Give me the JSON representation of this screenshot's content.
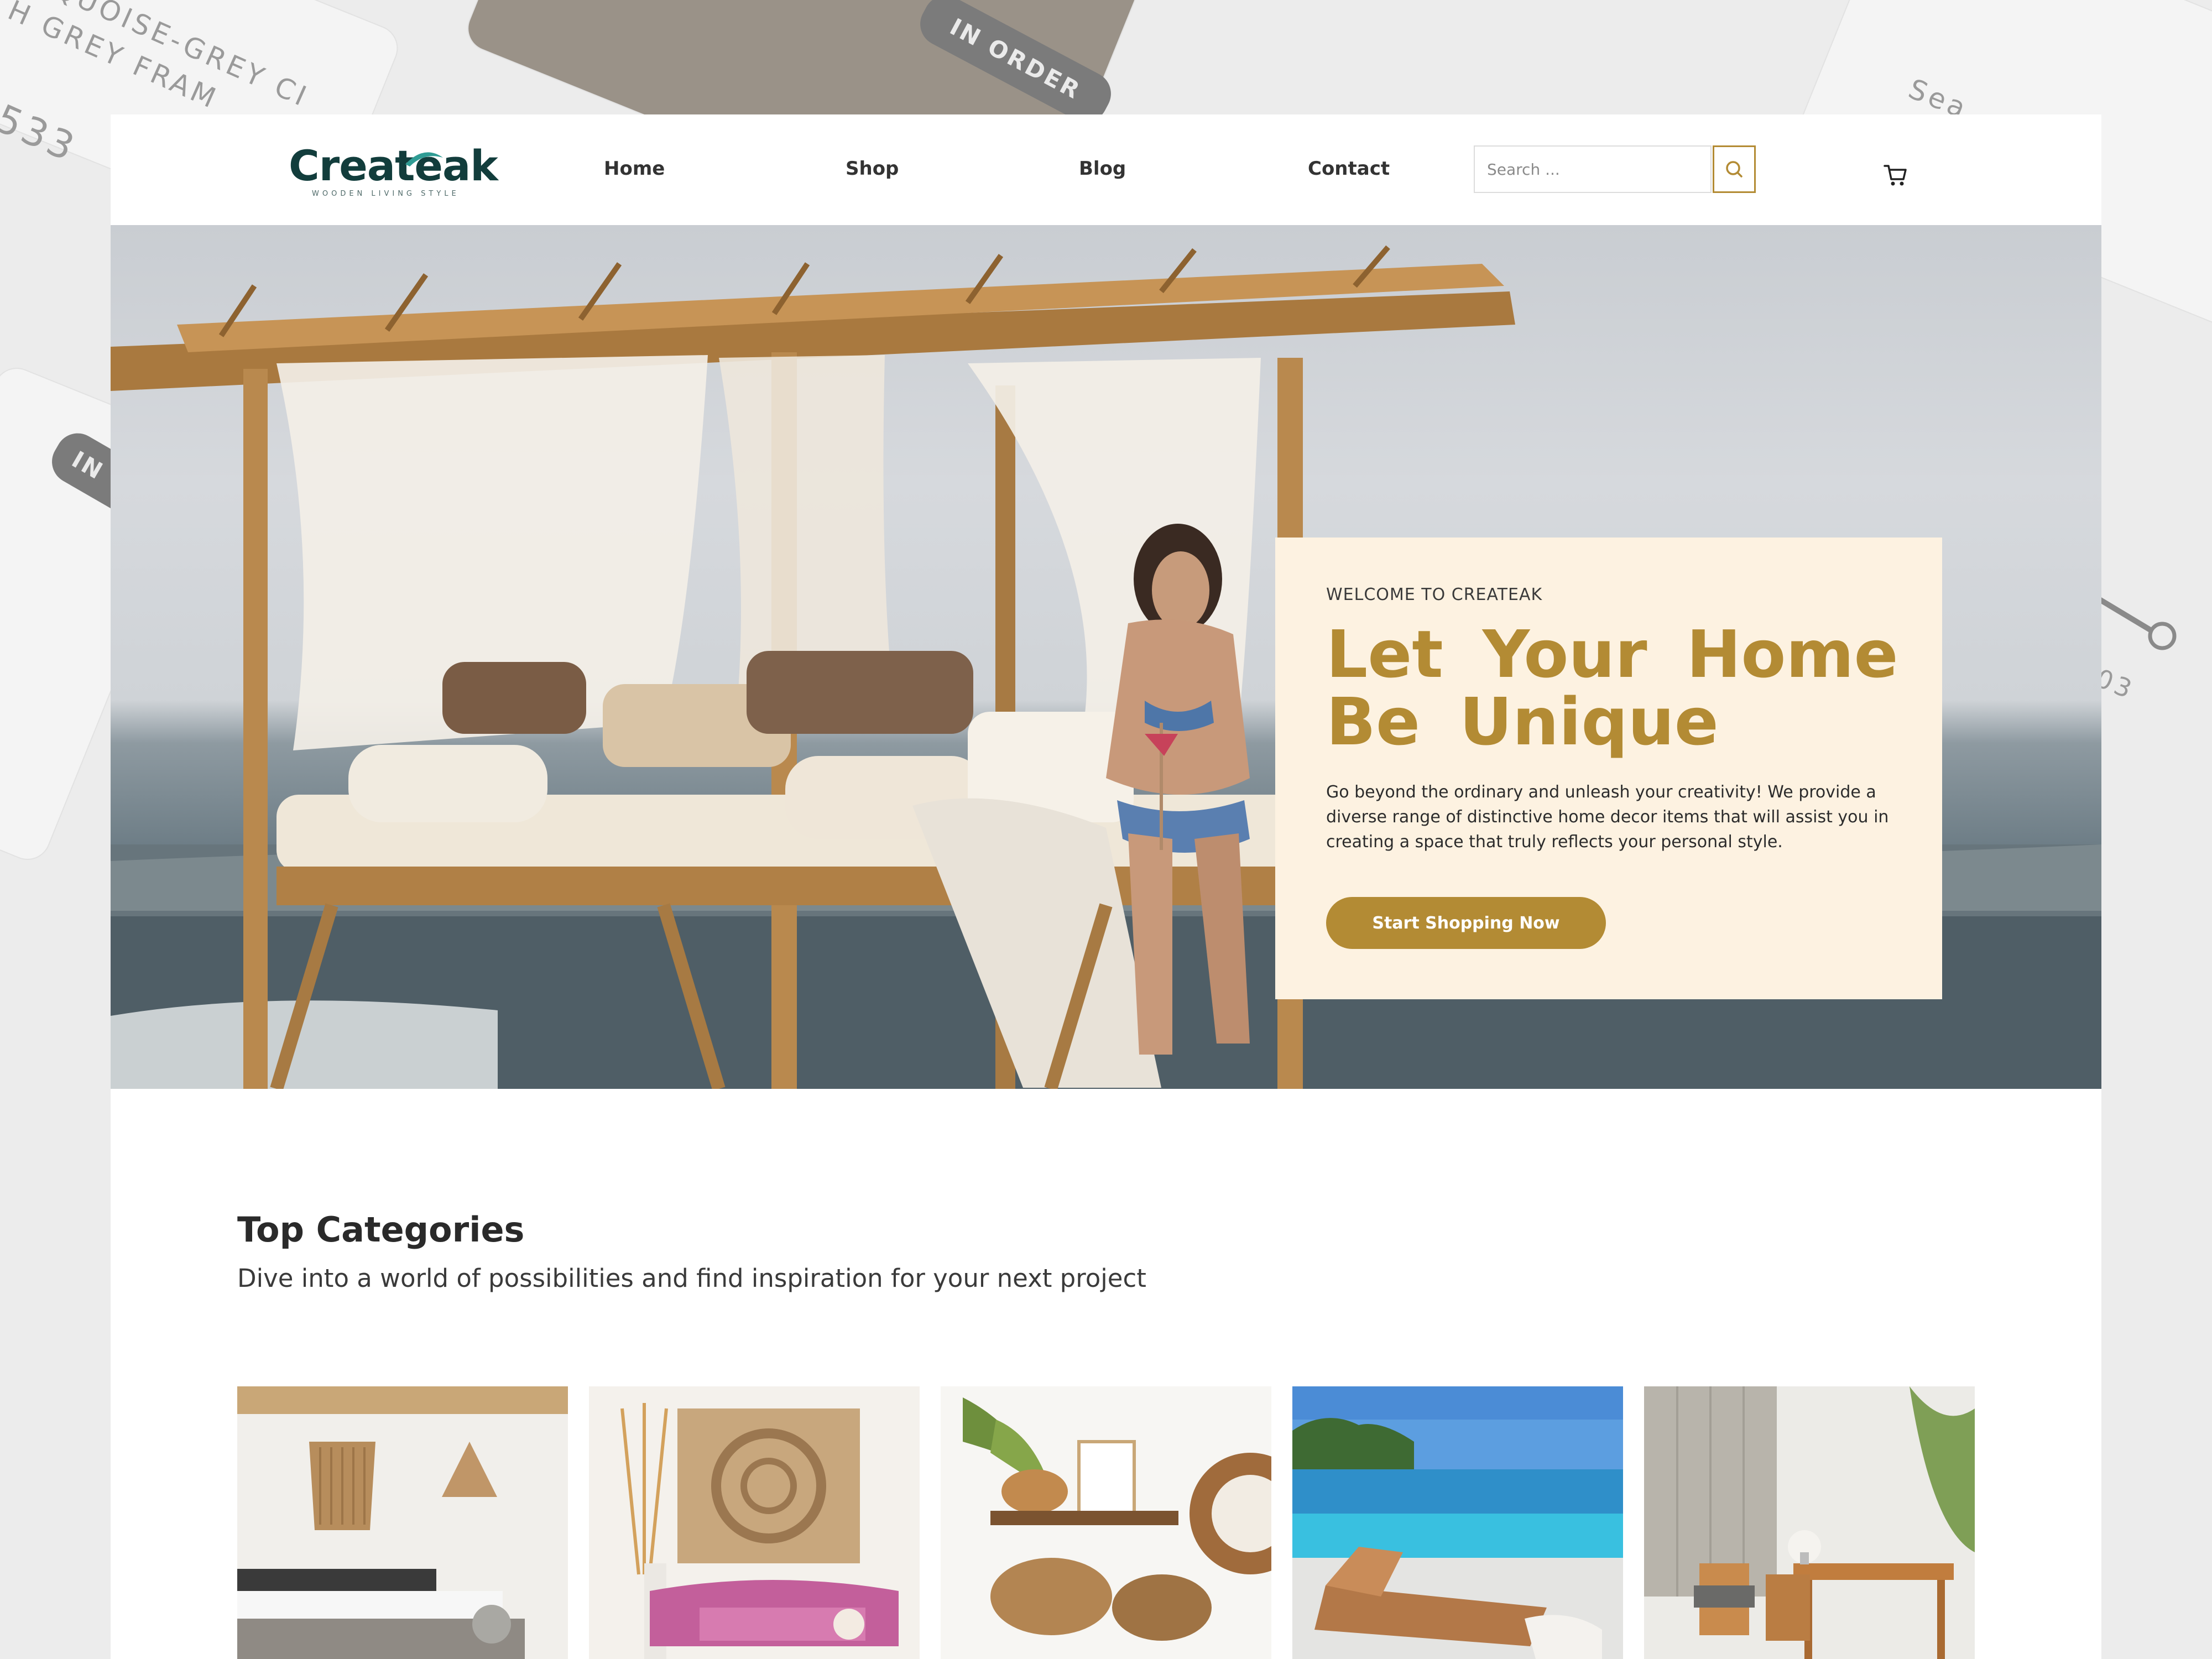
{
  "background": {
    "card_text_1": "RQUOISE-GREY CI",
    "card_text_2": "H GREY FRAM",
    "card_number": "533",
    "badge_1": "IN ORDER",
    "badge_2": "IN O",
    "search_fragment": "Sea",
    "number_fragment": "03"
  },
  "header": {
    "logo_text": "Createak",
    "logo_tagline": "WOODEN LIVING STYLE",
    "nav": [
      {
        "label": "Home"
      },
      {
        "label": "Shop"
      },
      {
        "label": "Blog"
      },
      {
        "label": "Contact"
      }
    ],
    "search_placeholder": "Search ...",
    "search_icon": "search-icon",
    "cart_icon": "cart-icon"
  },
  "hero": {
    "kicker": "WELCOME TO CREATEAK",
    "title": "Let Your Home Be Unique",
    "body": "Go beyond the ordinary and unleash your creativity! We provide a diverse range of distinctive home decor items that will assist you in creating a space that truly reflects your personal style.",
    "cta_label": "Start Shopping Now"
  },
  "categories": {
    "title": "Top Categories",
    "subtitle": "Dive into a world of possibilities and find inspiration for your next project"
  },
  "colors": {
    "accent": "#b38b34",
    "logo": "#123d3c",
    "promo_bg": "#fdf2e1",
    "text_dark": "#2a2a2a"
  }
}
